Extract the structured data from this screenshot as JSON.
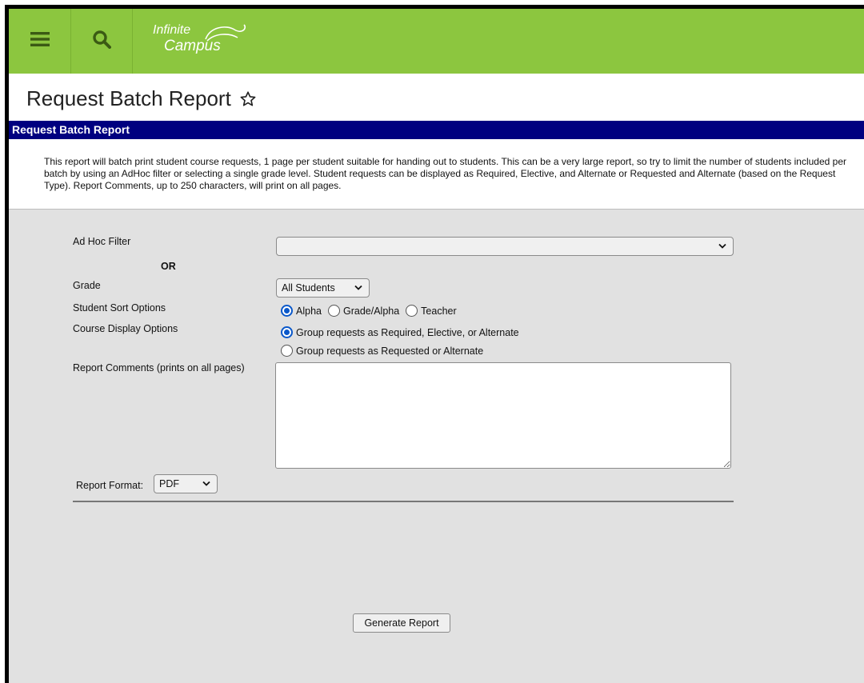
{
  "header": {
    "logo_line1": "Infinite",
    "logo_line2": "Campus",
    "menu_icon": "hamburger-menu-icon",
    "search_icon": "search-icon"
  },
  "page": {
    "title": "Request Batch Report",
    "favorite_icon": "star-outline-icon"
  },
  "section": {
    "title": "Request Batch Report",
    "description": "This report will batch print student course requests, 1 page per student suitable for handing out to students. This can be a very large report, so try to limit the number of students included per batch by using an AdHoc filter or selecting a single grade level. Student requests can be displayed as Required, Elective, and Alternate or Requested and Alternate (based on the Request Type). Report Comments, up to 250 characters, will print on all pages."
  },
  "form": {
    "adhoc_label": "Ad Hoc Filter",
    "adhoc_value": "",
    "or_label": "OR",
    "grade_label": "Grade",
    "grade_value": "All Students",
    "sort_label": "Student Sort Options",
    "sort_options": [
      {
        "label": "Alpha",
        "checked": true
      },
      {
        "label": "Grade/Alpha",
        "checked": false
      },
      {
        "label": "Teacher",
        "checked": false
      }
    ],
    "course_display_label": "Course Display Options",
    "course_display_options": [
      {
        "label": "Group requests as Required, Elective, or Alternate",
        "checked": true
      },
      {
        "label": "Group requests as Requested or Alternate",
        "checked": false
      }
    ],
    "comments_label": "Report Comments (prints on all pages)",
    "comments_value": "",
    "format_label": "Report Format:",
    "format_value": "PDF",
    "generate_label": "Generate Report"
  },
  "colors": {
    "header_green": "#8cc63f",
    "section_navy": "#000080",
    "form_gray": "#e1e1e1",
    "radio_blue": "#0a58ca"
  }
}
